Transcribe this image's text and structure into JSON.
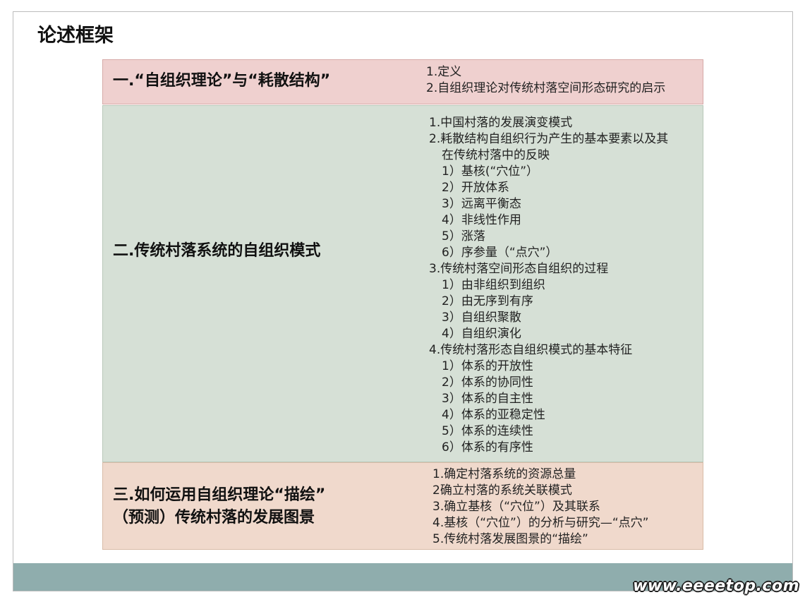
{
  "title": "论述框架",
  "sections": [
    {
      "heading": "一.“自组织理论”与“耗散结构”",
      "items": [
        "1.定义",
        "2.自组织理论对传统村落空间形态研究的启示"
      ]
    },
    {
      "heading": "二.传统村落系统的自组织模式",
      "groups": [
        {
          "lines": [
            "1.中国村落的发展演变模式"
          ],
          "subs": []
        },
        {
          "lines": [
            "2.耗散结构自组织行为产生的基本要素以及其",
            "在传统村落中的反映"
          ],
          "subs": [
            "1）基核(“穴位”）",
            "2）开放体系",
            "3）远离平衡态",
            "4）非线性作用",
            "5）涨落",
            "6）序参量（“点穴”）"
          ]
        },
        {
          "lines": [
            "3.传统村落空间形态自组织的过程"
          ],
          "subs": [
            "1）由非组织到组织",
            "2）由无序到有序",
            "3）自组织聚散",
            "4）自组织演化"
          ]
        },
        {
          "lines": [
            "4.传统村落形态自组织模式的基本特征"
          ],
          "subs": [
            "1）体系的开放性",
            "2）体系的协同性",
            "3）体系的自主性",
            "4）体系的亚稳定性",
            "5）体系的连续性",
            "6）体系的有序性"
          ]
        }
      ]
    },
    {
      "heading_lines": [
        "三.如何运用自组织理论“描绘”",
        "（预测）传统村落的发展图景"
      ],
      "items": [
        "1.确定村落系统的资源总量",
        "2确立村落的系统关联模式",
        "3.确立基核（“穴位”）及其联系",
        "4.基核（“穴位”）的分析与研究—“点穴”",
        "5.传统村落发展图景的“描绘”"
      ]
    }
  ],
  "watermark": "www.eeeetop.com",
  "colors": {
    "band1": "#efd0cf",
    "band2": "#d6e0d6",
    "band3": "#f0d9cc",
    "footer": "#8fadad"
  }
}
